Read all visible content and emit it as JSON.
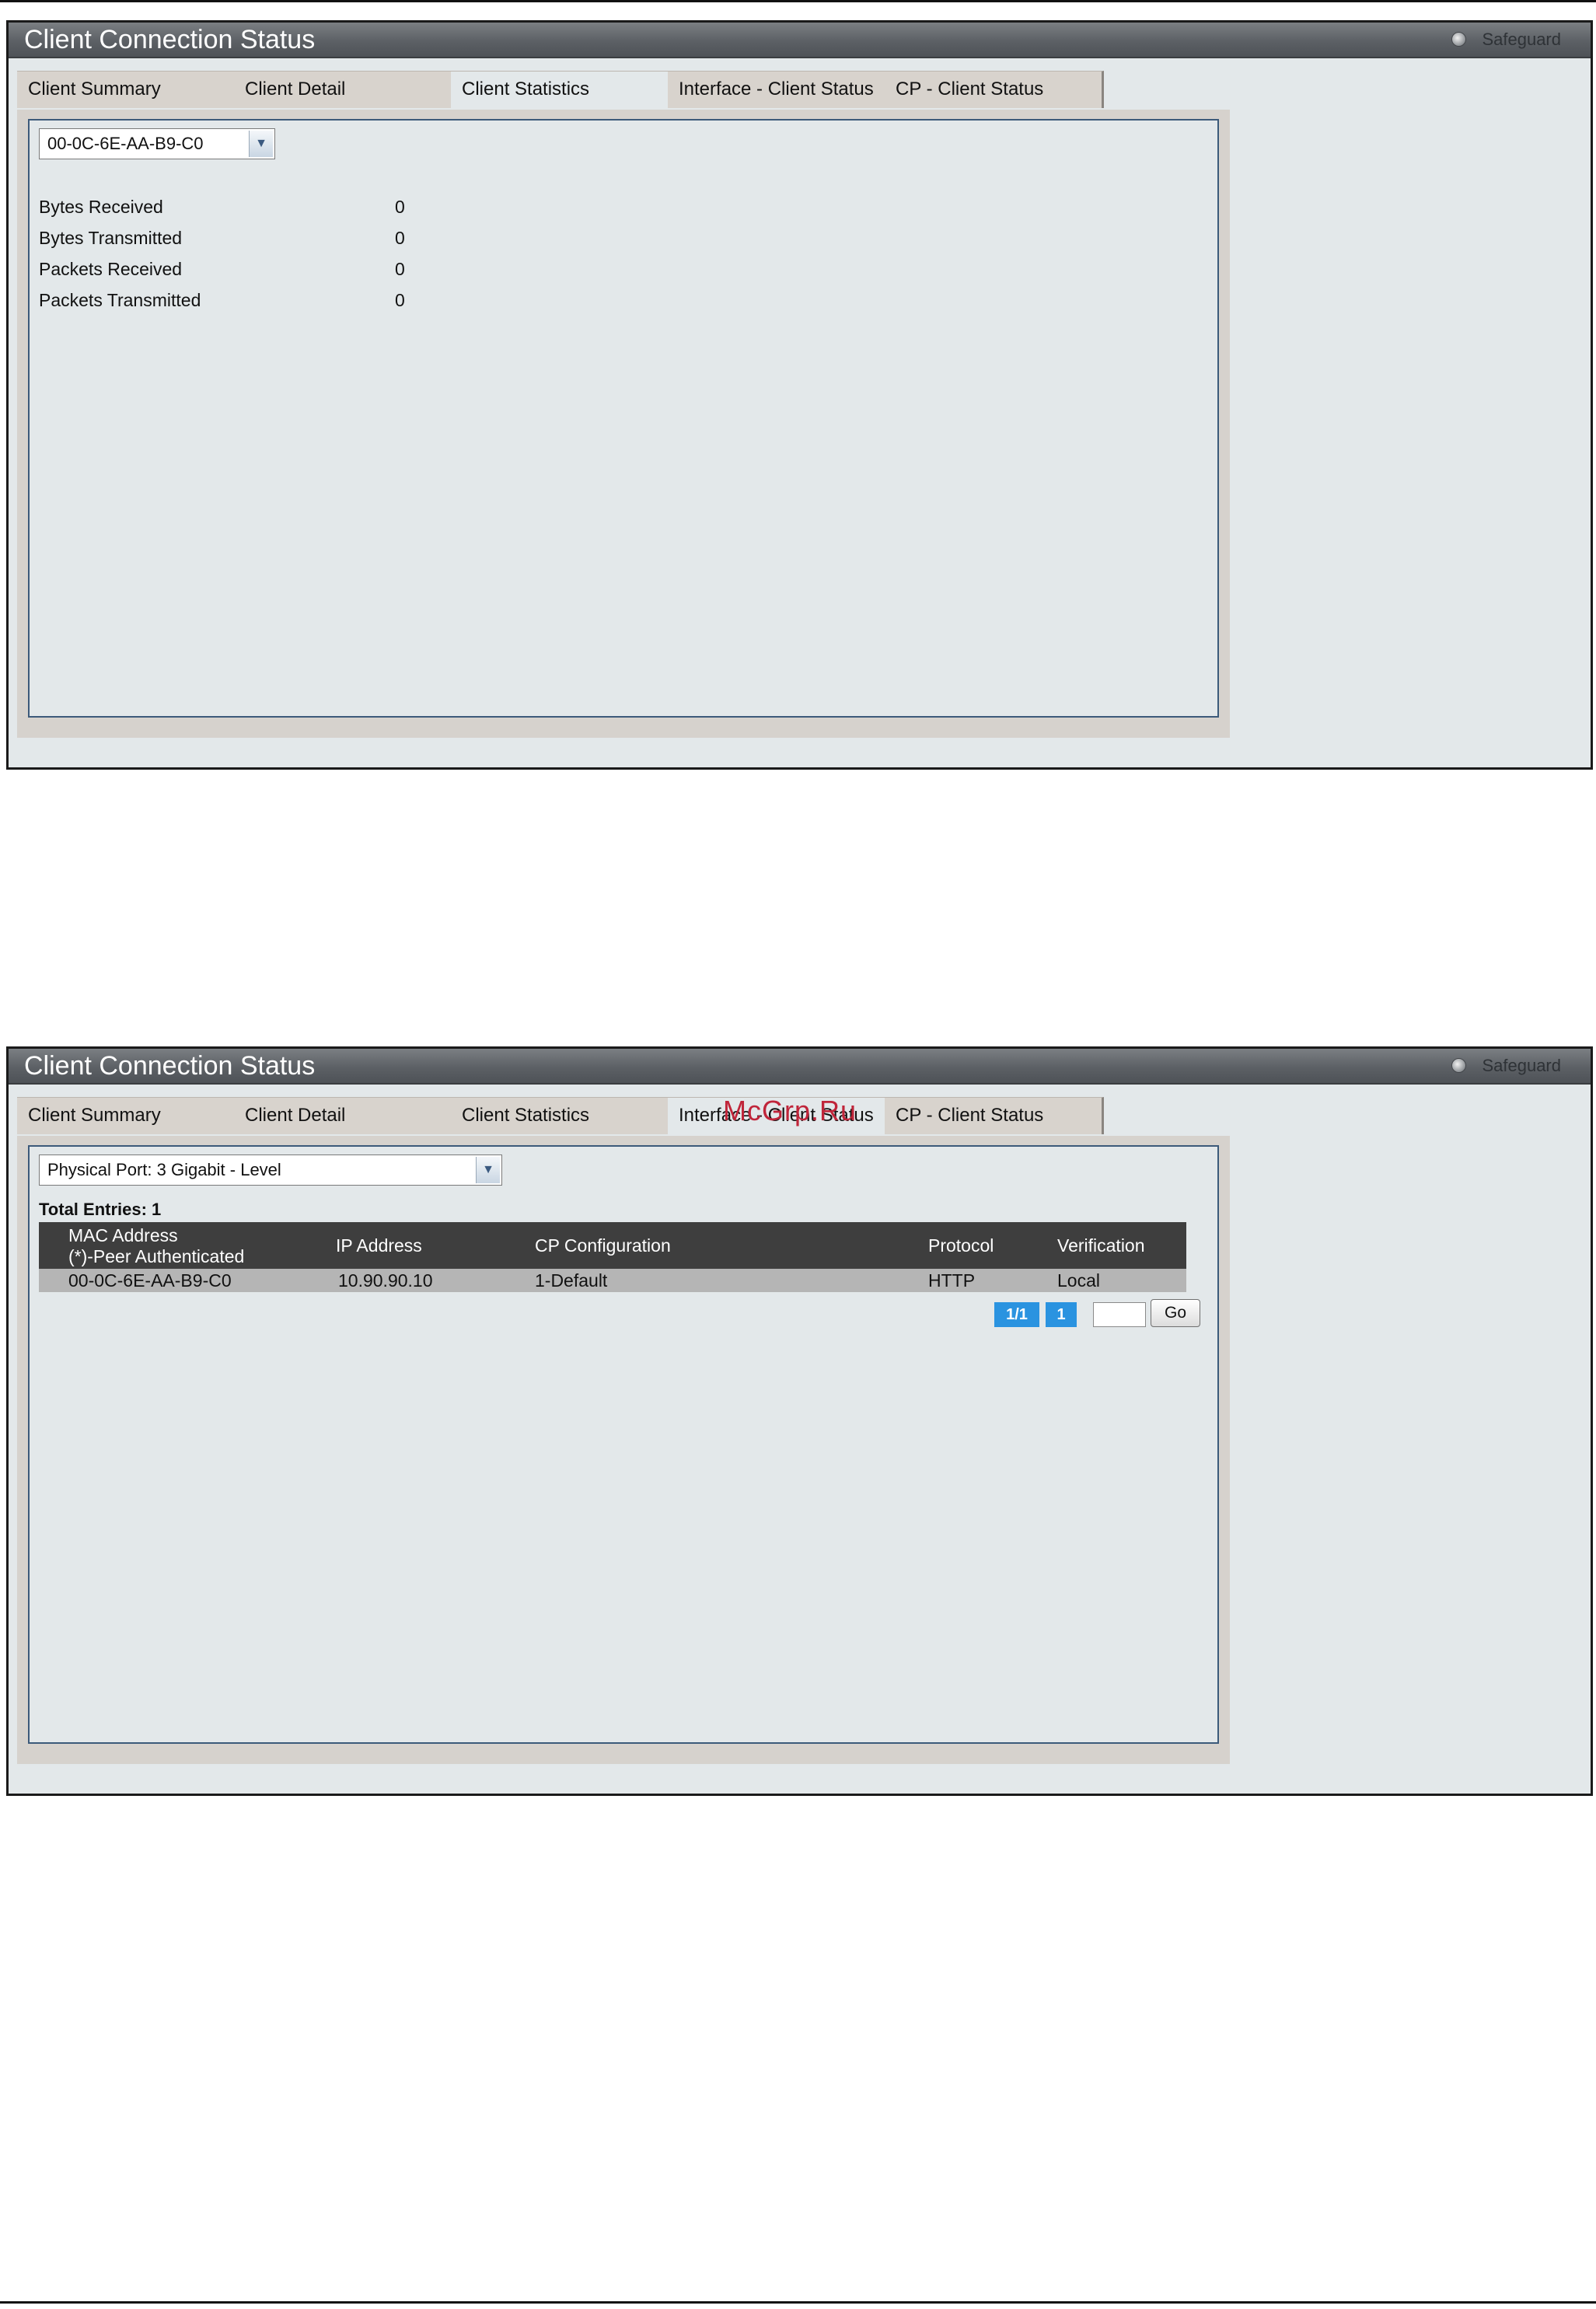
{
  "watermark": "McGrp.Ru",
  "panel1": {
    "title": "Client Connection Status",
    "safeguard": "Safeguard",
    "tabs": [
      "Client Summary",
      "Client Detail",
      "Client Statistics",
      "Interface - Client Status",
      "CP - Client Status"
    ],
    "active_tab": "Client Statistics",
    "mac_select": "00-0C-6E-AA-B9-C0",
    "stats": [
      {
        "label": "Bytes Received",
        "value": "0"
      },
      {
        "label": "Bytes Transmitted",
        "value": "0"
      },
      {
        "label": "Packets Received",
        "value": "0"
      },
      {
        "label": "Packets Transmitted",
        "value": "0"
      }
    ]
  },
  "panel2": {
    "title": "Client Connection Status",
    "safeguard": "Safeguard",
    "tabs": [
      "Client Summary",
      "Client Detail",
      "Client Statistics",
      "Interface - Client Status",
      "CP - Client Status"
    ],
    "active_tab": "Interface - Client Status",
    "port_select": "Physical Port: 3 Gigabit - Level",
    "total_entries": "Total Entries: 1",
    "table": {
      "headers": {
        "mac_line1": "MAC Address",
        "mac_line2": "(*)-Peer Authenticated",
        "ip": "IP Address",
        "cp": "CP Configuration",
        "protocol": "Protocol",
        "verification": "Verification"
      },
      "rows": [
        {
          "mac": "00-0C-6E-AA-B9-C0",
          "ip": "10.90.90.10",
          "cp": "1-Default",
          "protocol": "HTTP",
          "verification": "Local"
        }
      ]
    },
    "pagination": {
      "summary": "1/1",
      "page": "1",
      "go_label": "Go"
    }
  },
  "icons": {
    "safeguard": "safeguard-indicator-icon",
    "dropdown": "chevron-down-icon"
  }
}
